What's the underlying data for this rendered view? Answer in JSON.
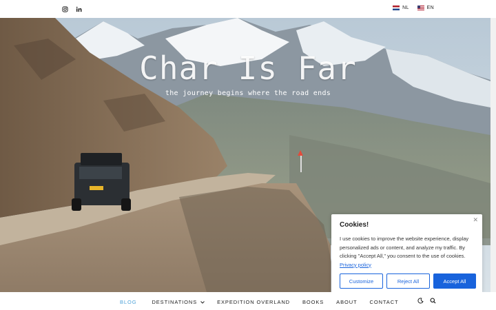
{
  "topbar": {
    "social": [
      "instagram-icon",
      "linkedin-icon"
    ],
    "languages": [
      {
        "code": "NL",
        "flag": "netherlands-flag"
      },
      {
        "code": "EN",
        "flag": "us-flag"
      }
    ]
  },
  "hero": {
    "title": "Char Is Far",
    "tagline": "the journey begins where the road ends"
  },
  "cookie": {
    "title": "Cookies!",
    "text": "I use cookies to improve the website experience, display personalized ads or content, and analyze my traffic. By clicking \"Accept All,\" you consent to the use of cookies.",
    "link": "Privacy policy",
    "customize": "Customize",
    "reject": "Reject All",
    "accept": "Accept All",
    "accent_color": "#1863dc"
  },
  "nav": {
    "items": [
      "BLOG",
      "DESTINATIONS",
      "EXPEDITION OVERLAND",
      "BOOKS",
      "ABOUT",
      "CONTACT"
    ],
    "active": "BLOG",
    "active_color": "#4fa3d9",
    "icons": [
      "dark-mode-icon",
      "search-icon"
    ]
  }
}
